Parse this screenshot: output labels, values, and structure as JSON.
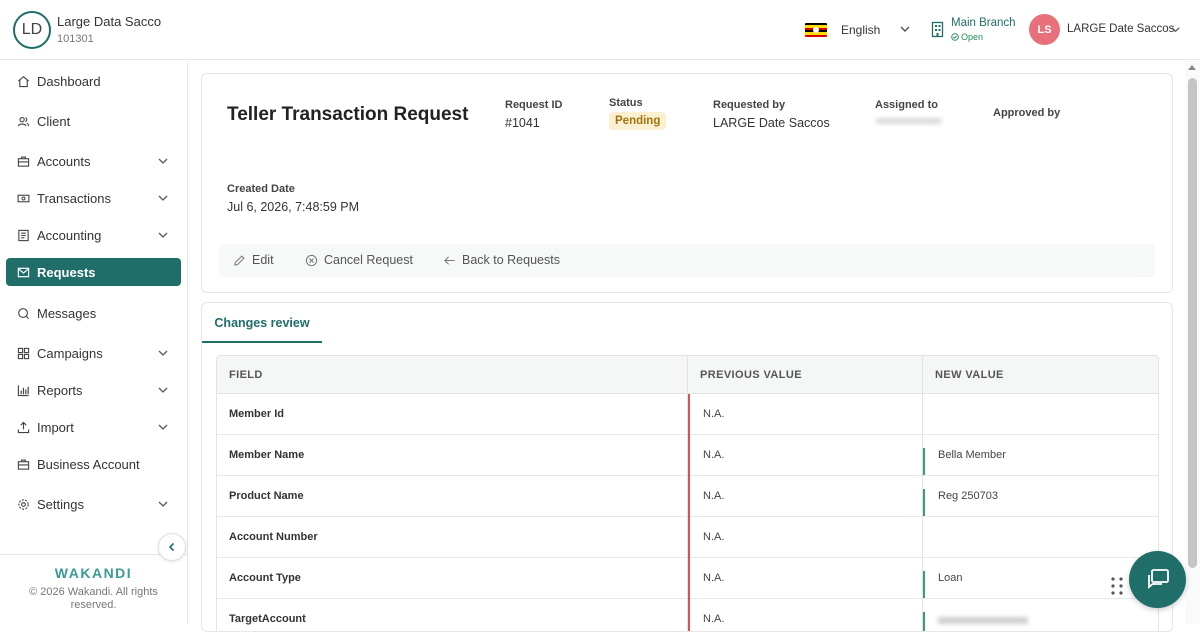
{
  "org": {
    "initials": "LD",
    "name": "Large Data Sacco",
    "code": "101301"
  },
  "header": {
    "language": "English",
    "branch": {
      "name": "Main Branch",
      "status": "Open"
    },
    "user": {
      "initials": "LS",
      "name": "LARGE Date Saccos"
    }
  },
  "sidebar": {
    "items": [
      {
        "label": "Dashboard",
        "icon": "home-icon"
      },
      {
        "label": "Client",
        "icon": "users-icon"
      },
      {
        "label": "Accounts",
        "icon": "briefcase-icon"
      },
      {
        "label": "Transactions",
        "icon": "money-icon"
      },
      {
        "label": "Accounting",
        "icon": "ledger-icon"
      },
      {
        "label": "Requests",
        "icon": "mail-icon"
      },
      {
        "label": "Messages",
        "icon": "chat-icon"
      },
      {
        "label": "Campaigns",
        "icon": "grid-icon"
      },
      {
        "label": "Reports",
        "icon": "bar-chart-icon"
      },
      {
        "label": "Import",
        "icon": "upload-icon"
      },
      {
        "label": "Business Account",
        "icon": "briefcase-icon"
      },
      {
        "label": "Settings",
        "icon": "gear-icon"
      }
    ],
    "active": "Requests",
    "brand": "WAKANDI",
    "copyright": "© 2026 Wakandi. All rights reserved."
  },
  "request": {
    "title": "Teller Transaction Request",
    "request_id_label": "Request ID",
    "request_id": "#1041",
    "status_label": "Status",
    "status": "Pending",
    "requested_by_label": "Requested by",
    "requested_by": "LARGE Date Saccos",
    "assigned_to_label": "Assigned to",
    "approved_by_label": "Approved by",
    "created_date_label": "Created Date",
    "created_date": "Jul 6, 2026, 7:48:59 PM",
    "actions": {
      "edit": "Edit",
      "cancel": "Cancel Request",
      "back": "Back to Requests"
    }
  },
  "review": {
    "tab": "Changes review",
    "columns": {
      "field": "FIELD",
      "previous": "PREVIOUS VALUE",
      "new": "NEW VALUE"
    },
    "rows": [
      {
        "field": "Member Id",
        "previous": "N.A.",
        "new": ""
      },
      {
        "field": "Member Name",
        "previous": "N.A.",
        "new": "Bella Member"
      },
      {
        "field": "Product Name",
        "previous": "N.A.",
        "new": "Reg 250703"
      },
      {
        "field": "Account Number",
        "previous": "N.A.",
        "new": ""
      },
      {
        "field": "Account Type",
        "previous": "N.A.",
        "new": "Loan"
      },
      {
        "field": "TargetAccount",
        "previous": "N.A.",
        "new": ""
      }
    ]
  },
  "colors": {
    "primary": "#1f6e69",
    "pending_bg": "#fbf0d2",
    "pending_text": "#a4720c",
    "removed": "#d9534f",
    "added": "#36a06a",
    "avatar": "#e8707a"
  }
}
